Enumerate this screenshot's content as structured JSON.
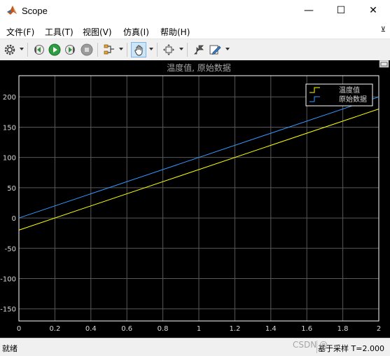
{
  "window": {
    "title": "Scope",
    "minimize_glyph": "—",
    "maximize_glyph": "☐",
    "close_glyph": "✕"
  },
  "menu": {
    "items": [
      "文件(F)",
      "工具(T)",
      "视图(V)",
      "仿真(I)",
      "帮助(H)"
    ],
    "pin_glyph": "⊻"
  },
  "toolbar": {
    "icons": [
      "settings-icon",
      "step-back-icon",
      "run-icon",
      "step-forward-icon",
      "stop-icon",
      "signal-select-icon",
      "pan-icon",
      "zoom-fit-icon",
      "style-icon",
      "edit-icon"
    ],
    "active": "pan-icon"
  },
  "plot": {
    "title": "温度值, 原始数据",
    "background": "#000000",
    "axes_color": "#ffffff",
    "grid_color": "#595959",
    "tick_label_color": "#d9d9d9",
    "title_color": "#a6a6a6"
  },
  "chart_data": {
    "type": "line",
    "title": "温度值, 原始数据",
    "xlabel": "",
    "ylabel": "",
    "xlim": [
      0,
      2
    ],
    "ylim": [
      -170,
      235
    ],
    "x_ticks": [
      "0",
      "0.2",
      "0.4",
      "0.6",
      "0.8",
      "1",
      "1.2",
      "1.4",
      "1.6",
      "1.8",
      "2"
    ],
    "y_ticks": [
      "200",
      "150",
      "100",
      "50",
      "0",
      "-50",
      "-100",
      "-150"
    ],
    "grid": true,
    "legend_position": "top-right",
    "series": [
      {
        "name": "温度值",
        "color": "#ffff00",
        "x": [
          0,
          2
        ],
        "values": [
          -20,
          180
        ]
      },
      {
        "name": "原始数据",
        "color": "#3399ff",
        "x": [
          0,
          2
        ],
        "values": [
          0,
          200
        ]
      }
    ]
  },
  "status": {
    "left": "就绪",
    "right": "基于采样  T=2.000",
    "watermark": "CSDN @"
  }
}
